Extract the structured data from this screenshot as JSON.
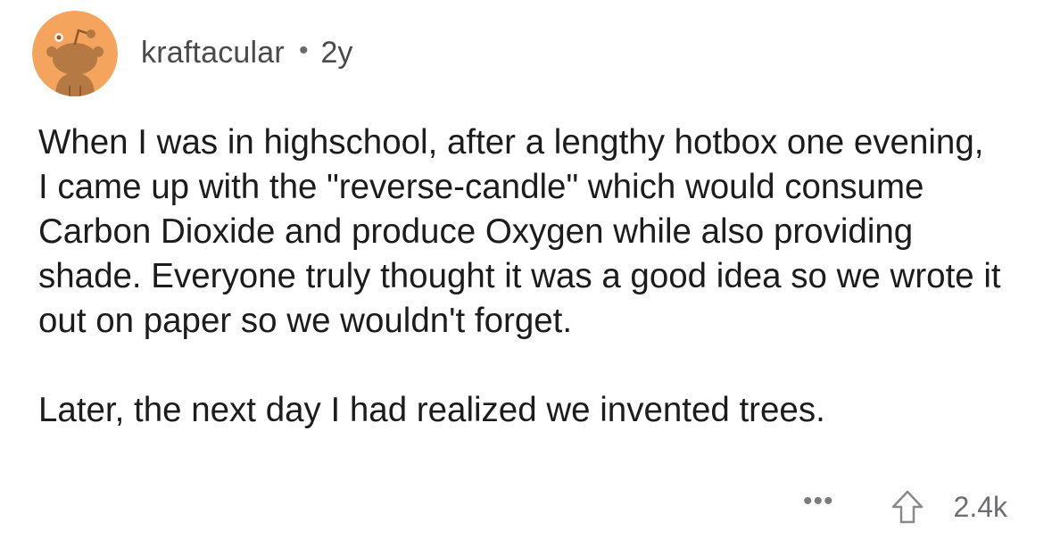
{
  "comment": {
    "username": "kraftacular",
    "separator": "•",
    "age": "2y",
    "paragraphs": [
      "When I was in highschool, after a lengthy hotbox one evening, I came up with the \"reverse-candle\" which would consume Carbon Dioxide and produce Oxygen while also providing shade. Everyone truly thought it was a good idea so we wrote it out on paper so we wouldn't forget.",
      "Later, the next day I had realized we invented trees."
    ],
    "more_label": "•••",
    "score": "2.4k",
    "avatar_icon": "snoo-avatar-icon",
    "upvote_icon": "upvote-arrow-icon"
  },
  "colors": {
    "avatar_bg": "#F4A261",
    "avatar_figure": "#B0743E",
    "text": "#1C1C1D",
    "meta_text": "#4A4A4C",
    "muted": "#7C7C7E"
  }
}
